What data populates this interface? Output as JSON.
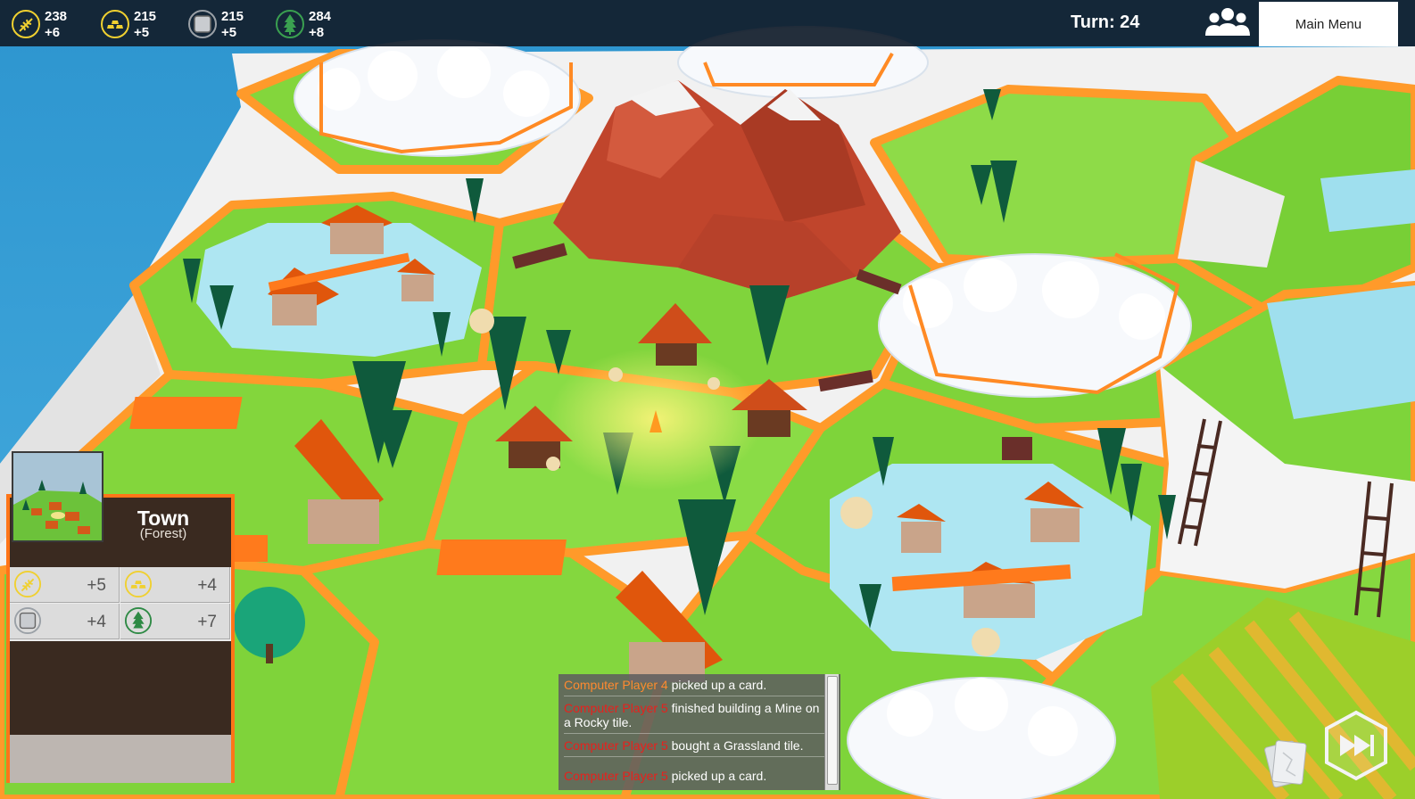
{
  "resources": [
    {
      "id": "food",
      "icon": "wheat-icon",
      "amount": "238",
      "rate": "+6"
    },
    {
      "id": "gold",
      "icon": "gold-bars-icon",
      "amount": "215",
      "rate": "+5"
    },
    {
      "id": "stone",
      "icon": "stone-block-icon",
      "amount": "215",
      "rate": "+5"
    },
    {
      "id": "wood",
      "icon": "tree-icon",
      "amount": "284",
      "rate": "+8"
    }
  ],
  "turn_label": "Turn: 24",
  "players_button": "players-icon",
  "main_menu_label": "Main Menu",
  "selected_tile": {
    "name": "Town",
    "type": "(Forest)",
    "yields": [
      {
        "icon": "wheat-icon",
        "amount": "+5"
      },
      {
        "icon": "gold-bars-icon",
        "amount": "+4"
      },
      {
        "icon": "stone-block-icon",
        "amount": "+4"
      },
      {
        "icon": "tree-icon",
        "amount": "+7"
      }
    ]
  },
  "event_log": [
    {
      "player": "Computer Player 4",
      "player_color": "#ff8a30",
      "text": " picked up a card."
    },
    {
      "player": "Computer Player 5",
      "player_color": "#e8201c",
      "text": " finished building a Mine on a Rocky tile."
    },
    {
      "player": "Computer Player 5",
      "player_color": "#e8201c",
      "text": " bought a Grassland tile."
    },
    {
      "player": "Computer Player 5",
      "player_color": "#e8201c",
      "text": " picked up a card."
    }
  ],
  "buttons": {
    "cards": "cards-icon",
    "end_turn": "fast-forward-icon"
  },
  "colors": {
    "accent": "#ff7518",
    "resource_icon": "#f0d030",
    "water": "#3ea2d6",
    "grass": "#7ed43a",
    "mountain": "#c0452c"
  }
}
